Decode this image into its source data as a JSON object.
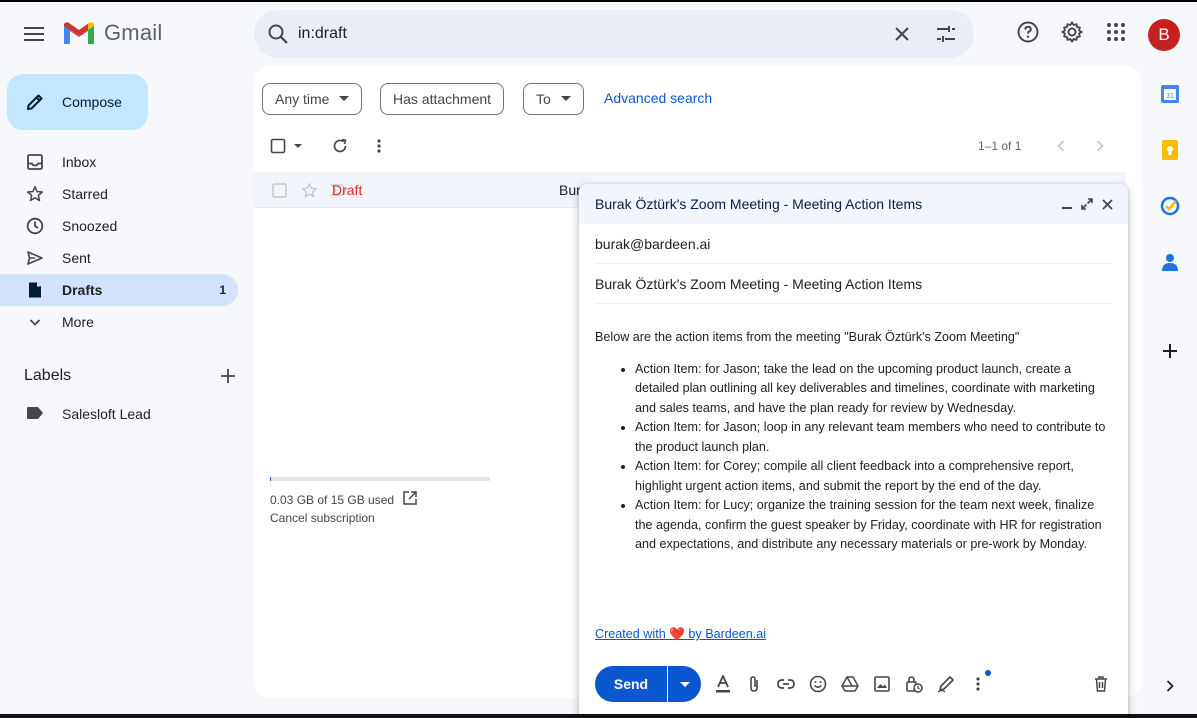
{
  "app": {
    "logo_text": "Gmail",
    "avatar_letter": "B",
    "avatar_color": "#c5221f",
    "accent_color": "#0b57d0"
  },
  "search": {
    "value": "in:draft"
  },
  "sidebar": {
    "compose_label": "Compose",
    "items": [
      {
        "label": "Inbox",
        "icon": "inbox-icon"
      },
      {
        "label": "Starred",
        "icon": "star-icon"
      },
      {
        "label": "Snoozed",
        "icon": "clock-icon"
      },
      {
        "label": "Sent",
        "icon": "send-icon"
      },
      {
        "label": "Drafts",
        "icon": "draft-icon",
        "count": "1",
        "active": true
      },
      {
        "label": "More",
        "icon": "chevron-down-icon"
      }
    ],
    "labels_heading": "Labels",
    "labels": [
      {
        "label": "Salesloft Lead",
        "icon": "label-icon"
      }
    ]
  },
  "filters": {
    "any_time": "Any time",
    "has_attachment": "Has attachment",
    "to": "To",
    "advanced_search": "Advanced search"
  },
  "list": {
    "pager": "1–1 of 1",
    "rows": [
      {
        "status": "Draft",
        "sender_partial": "Bur"
      }
    ]
  },
  "storage": {
    "used_text": "0.03 GB of 15 GB used",
    "cancel_text": "Cancel subscription",
    "fraction_used": 0.002
  },
  "compose_window": {
    "title": "Burak Öztürk's Zoom Meeting - Meeting Action Items",
    "to": "burak@bardeen.ai",
    "subject": "Burak Öztürk's Zoom Meeting - Meeting Action Items",
    "intro": "Below are the action items from the meeting \"Burak Öztürk's Zoom Meeting\"",
    "items": [
      "Action Item: for Jason; take the lead on the upcoming product launch, create a detailed plan outlining all key deliverables and timelines, coordinate with marketing and sales teams, and have the plan ready for review by Wednesday.",
      "Action Item: for Jason; loop in any relevant team members who need to contribute to the product launch plan.",
      "Action Item: for Corey; compile all client feedback into a comprehensive report, highlight urgent action items, and submit the report by the end of the day.",
      "Action Item: for Lucy; organize the training session for the team next week, finalize the agenda, confirm the guest speaker by Friday, coordinate with HR for registration and expectations, and distribute any necessary materials or pre-work by Monday."
    ],
    "signature_pre": "Created with ",
    "signature_heart": "❤️",
    "signature_post": " by Bardeen.ai",
    "send_label": "Send"
  }
}
